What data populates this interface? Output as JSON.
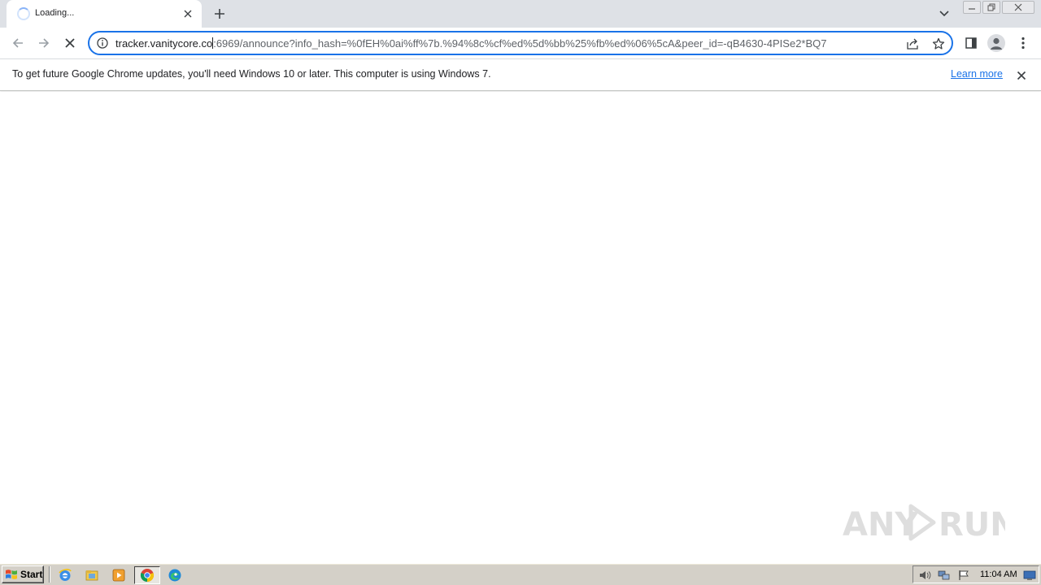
{
  "tab": {
    "title": "Loading...",
    "close_icon": "close-icon",
    "status_icon": "loading-spinner-icon"
  },
  "tabstrip": {
    "new_tab_icon": "plus-icon",
    "tab_search_icon": "chevron-down-icon"
  },
  "toolbar": {
    "back_icon": "arrow-left-icon",
    "forward_icon": "arrow-right-icon",
    "stop_icon": "close-icon",
    "side_panel_icon": "side-panel-icon",
    "profile_icon": "person-icon",
    "menu_icon": "kebab-menu-icon"
  },
  "omnibox": {
    "url_host": "tracker.vanitycore.co",
    "url_rest": ":6969/announce?info_hash=%0fEH%0ai%ff%7b.%94%8c%cf%ed%5d%bb%25%fb%ed%06%5cA&peer_id=-qB4630-4PISe2*BQ7",
    "info_icon": "info-icon",
    "share_icon": "share-icon",
    "bookmark_icon": "star-icon"
  },
  "infobar": {
    "message": "To get future Google Chrome updates, you'll need Windows 10 or later. This computer is using Windows 7.",
    "link_label": "Learn more",
    "close_icon": "close-icon"
  },
  "watermark": {
    "text": "ANY RUN"
  },
  "taskbar": {
    "start_label": "Start",
    "quicklaunch": [
      "internet-explorer-icon",
      "file-explorer-icon",
      "media-player-icon",
      "chrome-icon",
      "edge-icon"
    ],
    "clock": "11:04 AM"
  },
  "colors": {
    "accent": "#1a73e8",
    "tabstrip_bg": "#dee1e6",
    "taskbar_bg": "#d4d0c8"
  }
}
